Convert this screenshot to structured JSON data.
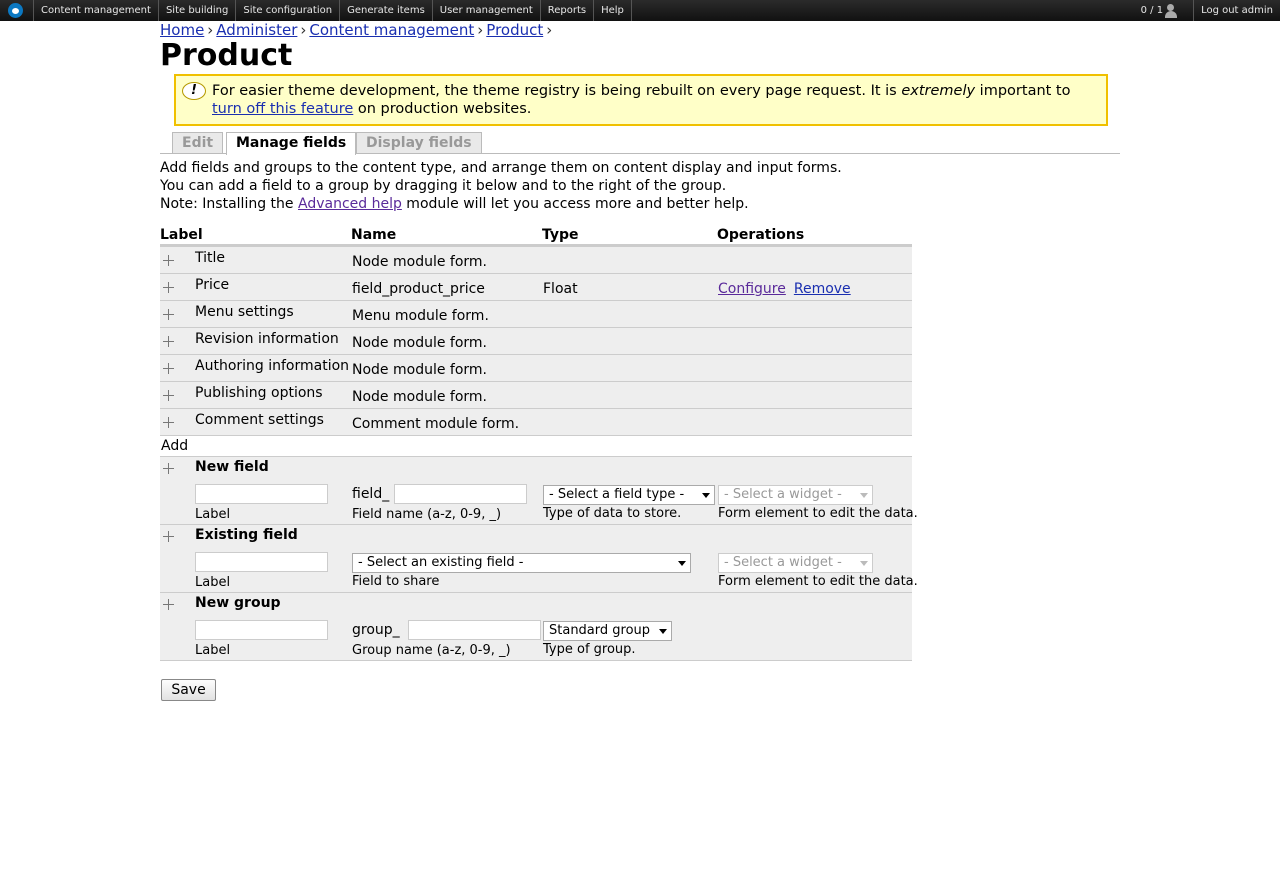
{
  "toolbar": {
    "menu": [
      "Content management",
      "Site building",
      "Site configuration",
      "Generate items",
      "User management",
      "Reports",
      "Help"
    ],
    "user_count": "0 / 1",
    "logout": "Log out admin"
  },
  "breadcrumb": [
    "Home",
    "Administer",
    "Content management",
    "Product"
  ],
  "page_title": "Product",
  "message": {
    "part1": "For easier theme development, the theme registry is being rebuilt on every page request. It is ",
    "emphasis": "extremely",
    "part2": " important to ",
    "link": "turn off this feature",
    "part3": " on production websites."
  },
  "tabs": [
    "Edit",
    "Manage fields",
    "Display fields"
  ],
  "help": {
    "line1": "Add fields and groups to the content type, and arrange them on content display and input forms.",
    "line2": "You can add a field to a group by dragging it below and to the right of the group.",
    "line3_before": "Note: Installing the ",
    "line3_link": "Advanced help",
    "line3_after": " module will let you access more and better help."
  },
  "table": {
    "headers": [
      "Label",
      "Name",
      "Type",
      "Operations"
    ],
    "rows": [
      {
        "label": "Title",
        "name": "Node module form.",
        "type": "",
        "configure": "",
        "remove": ""
      },
      {
        "label": "Price",
        "name": "field_product_price",
        "type": "Float",
        "configure": "Configure",
        "remove": "Remove"
      },
      {
        "label": "Menu settings",
        "name": "Menu module form.",
        "type": "",
        "configure": "",
        "remove": ""
      },
      {
        "label": "Revision information",
        "name": "Node module form.",
        "type": "",
        "configure": "",
        "remove": ""
      },
      {
        "label": "Authoring information",
        "name": "Node module form.",
        "type": "",
        "configure": "",
        "remove": ""
      },
      {
        "label": "Publishing options",
        "name": "Node module form.",
        "type": "",
        "configure": "",
        "remove": ""
      },
      {
        "label": "Comment settings",
        "name": "Comment module form.",
        "type": "",
        "configure": "",
        "remove": ""
      }
    ],
    "add_label": "Add"
  },
  "new_field": {
    "title": "New field",
    "label_value": "",
    "label_desc": "Label",
    "prefix": "field_",
    "name_value": "",
    "name_desc": "Field name (a-z, 0-9, _)",
    "type_select": "- Select a field type -",
    "type_desc": "Type of data to store.",
    "widget_select": "- Select a widget -",
    "widget_desc": "Form element to edit the data."
  },
  "existing_field": {
    "title": "Existing field",
    "label_value": "",
    "label_desc": "Label",
    "field_select": "- Select an existing field -",
    "field_desc": "Field to share",
    "widget_select": "- Select a widget -",
    "widget_desc": "Form element to edit the data."
  },
  "new_group": {
    "title": "New group",
    "label_value": "",
    "label_desc": "Label",
    "prefix": "group_",
    "name_value": "",
    "name_desc": "Group name (a-z, 0-9, _)",
    "type_select": "Standard group",
    "type_desc": "Type of group."
  },
  "save_label": "Save"
}
